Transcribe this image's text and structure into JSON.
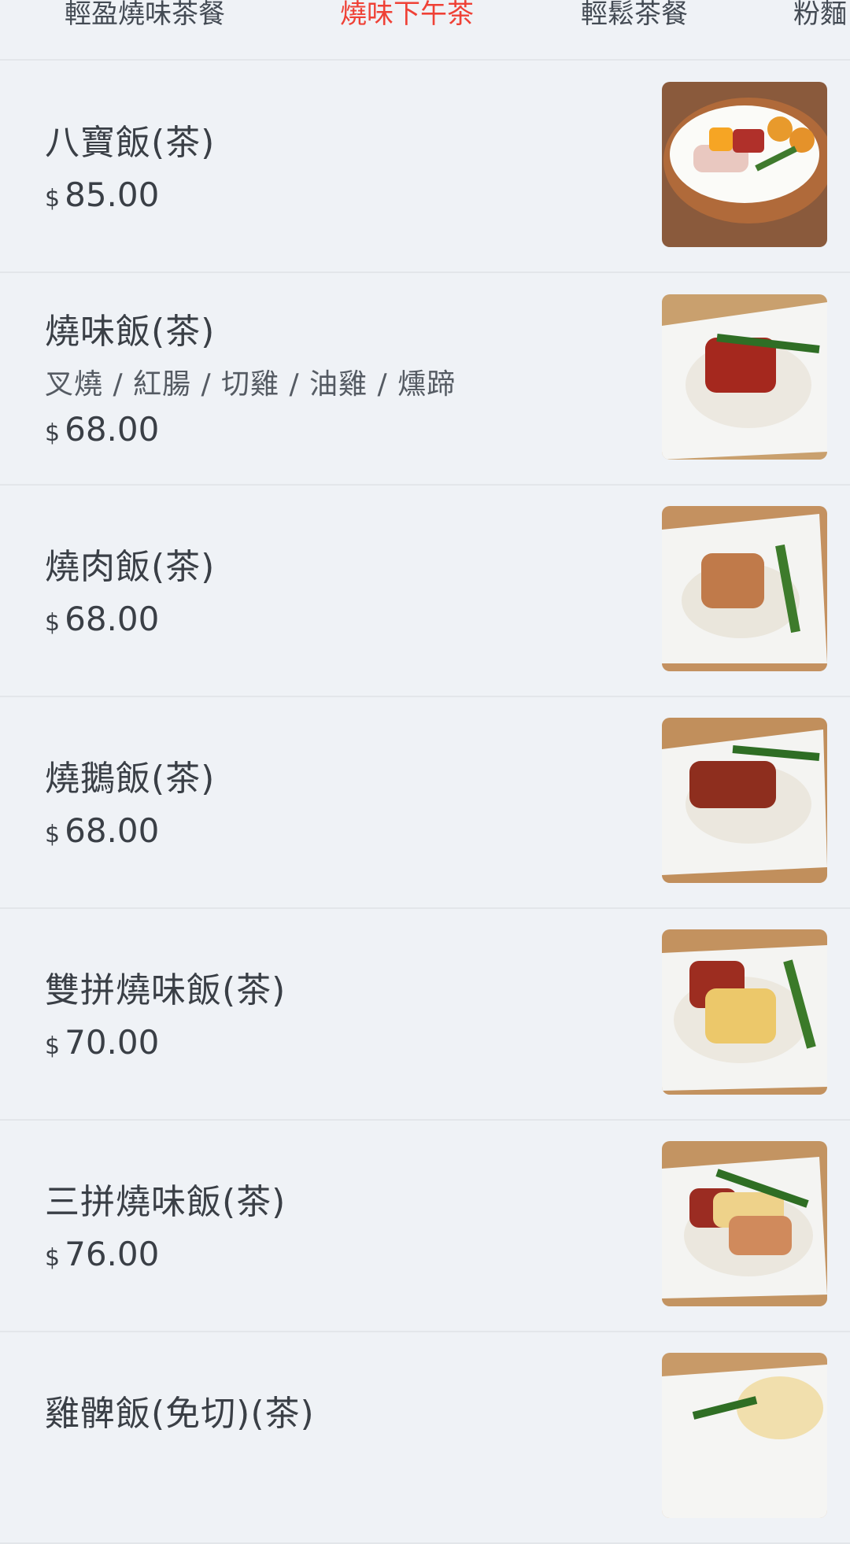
{
  "tabs": [
    {
      "label": "輕盈燒味茶餐"
    },
    {
      "label": "燒味下午茶"
    },
    {
      "label": "輕鬆茶餐"
    },
    {
      "label": "粉麵"
    }
  ],
  "active_tab_color": "#ef4136",
  "currency_symbol": "$",
  "items": [
    {
      "name": "八寶飯(茶)",
      "description": "",
      "price": "85.00",
      "image": "eight-treasure-rice-photo"
    },
    {
      "name": "燒味飯(茶)",
      "description": "叉燒 / 紅腸 / 切雞 / 油雞 /  燻蹄",
      "price": "68.00",
      "image": "bbq-pork-rice-photo"
    },
    {
      "name": "燒肉飯(茶)",
      "description": "",
      "price": "68.00",
      "image": "roast-pork-rice-photo"
    },
    {
      "name": "燒鵝飯(茶)",
      "description": "",
      "price": "68.00",
      "image": "roast-goose-rice-photo"
    },
    {
      "name": "雙拼燒味飯(茶)",
      "description": "",
      "price": "70.00",
      "image": "two-bbq-combo-rice-photo"
    },
    {
      "name": "三拼燒味飯(茶)",
      "description": "",
      "price": "76.00",
      "image": "three-bbq-combo-rice-photo"
    },
    {
      "name": "雞髀飯(免切)(茶)",
      "description": "",
      "price": "",
      "image": "chicken-leg-rice-photo"
    }
  ]
}
